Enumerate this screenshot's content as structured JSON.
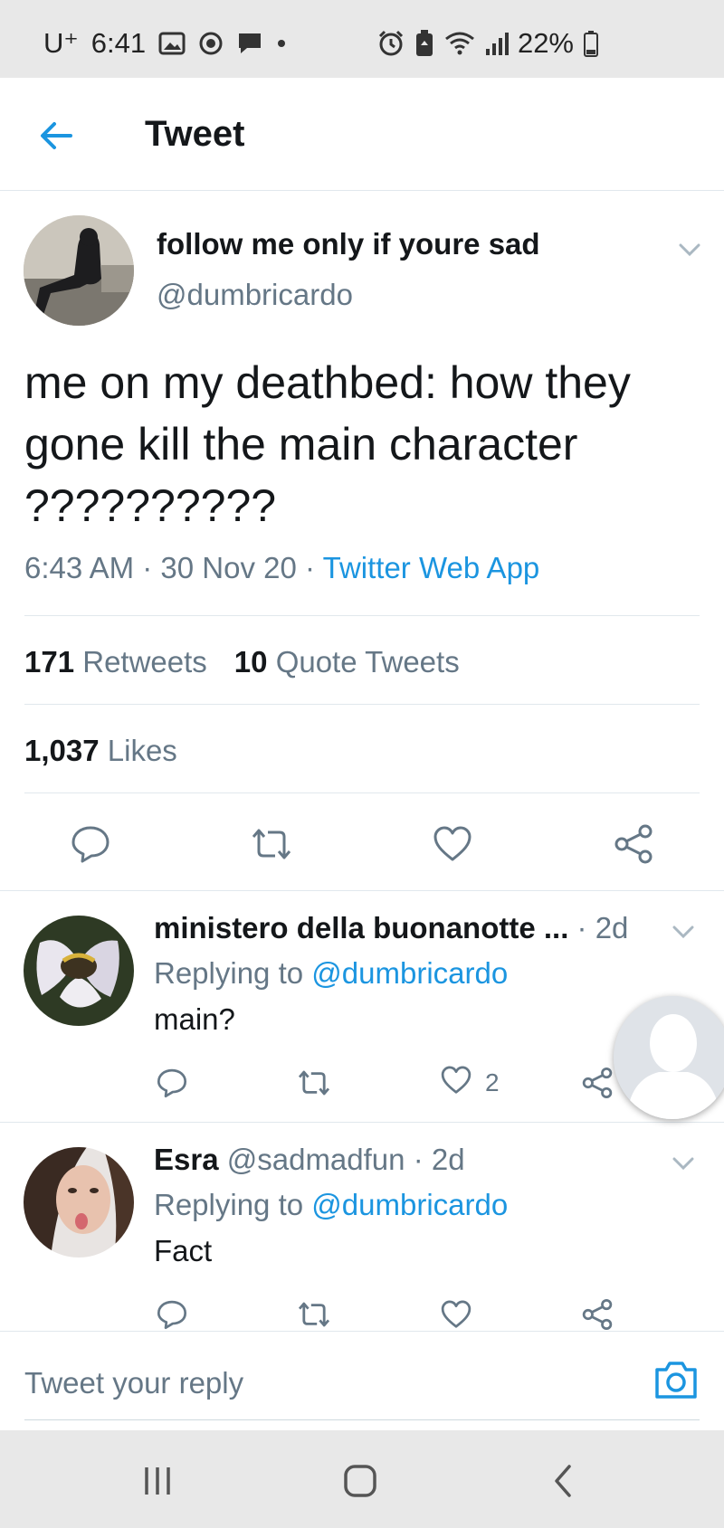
{
  "status_bar": {
    "carrier_icon": "U⁺",
    "time": "6:41",
    "battery": "22%",
    "icons_left": [
      "image-icon",
      "media-icon",
      "chat-icon",
      "dot-icon"
    ],
    "icons_right": [
      "alarm-icon",
      "battery-saver-icon",
      "wifi-icon",
      "signal-icon",
      "battery-icon"
    ]
  },
  "header": {
    "title": "Tweet",
    "back_icon": "back-arrow-icon"
  },
  "tweet": {
    "display_name": "follow me only if youre sad",
    "handle": "@dumbricardo",
    "text": "me on my deathbed: how they gone kill the main character ??????????",
    "time": "6:43 AM",
    "date": "30 Nov 20",
    "separator": "·",
    "source": "Twitter Web App",
    "retweets_count": "171",
    "retweets_label": "Retweets",
    "quotes_count": "10",
    "quotes_label": "Quote Tweets",
    "likes_count": "1,037",
    "likes_label": "Likes"
  },
  "replies": [
    {
      "display_name": "ministero della buonanotte ...",
      "time": "· 2d",
      "replying_prefix": "Replying to",
      "replying_to": "@dumbricardo",
      "text": "main?",
      "like_count": "2"
    },
    {
      "display_name": "Esra",
      "handle": "@sadmadfun",
      "time": "· 2d",
      "replying_prefix": "Replying to",
      "replying_to": "@dumbricardo",
      "text": "Fact"
    }
  ],
  "composer": {
    "placeholder": "Tweet your reply"
  },
  "colors": {
    "accent": "#1b95e0",
    "muted": "#657786",
    "text": "#14171a",
    "divider": "#e1e8ed"
  }
}
